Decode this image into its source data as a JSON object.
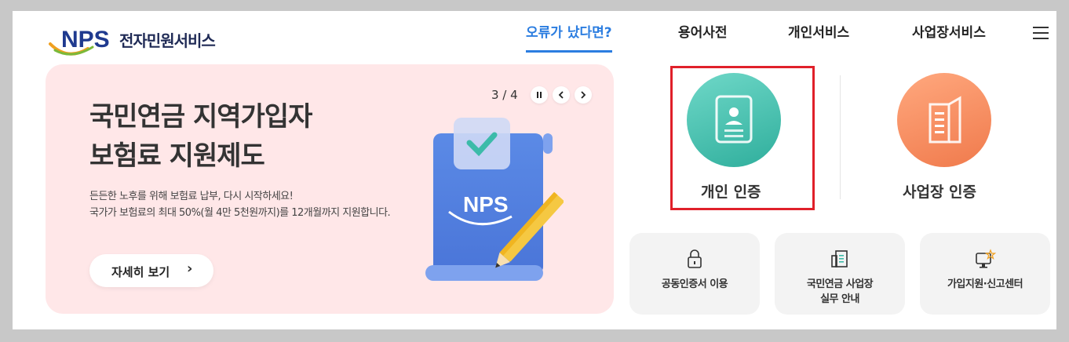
{
  "header": {
    "logo_text": "NPS",
    "service_name": "전자민원서비스"
  },
  "nav": {
    "items": [
      {
        "label": "오류가 났다면?",
        "active": true
      },
      {
        "label": "용어사전",
        "active": false
      },
      {
        "label": "개인서비스",
        "active": false
      },
      {
        "label": "사업장서비스",
        "active": false
      }
    ],
    "menu_icon": "hamburger-icon"
  },
  "banner": {
    "title_line1": "국민연금 지역가입자",
    "title_line2": "보험료 지원제도",
    "desc_line1": "든든한 노후를 위해 보험료 납부, 다시 시작하세요!",
    "desc_line2": "국가가 보험료의 최대 50%(월 4만 5천원까지)를 12개월까지 지원합니다.",
    "detail_button": "자세히 보기",
    "detail_chevron": "›",
    "pager": {
      "current": 3,
      "total": 4,
      "text": "3 / 4"
    },
    "pause_icon": "pause-icon",
    "prev_icon": "chevron-left-icon",
    "next_icon": "chevron-right-icon",
    "illustration_text": "NPS",
    "background": "#ffe7e8"
  },
  "auth": {
    "personal": {
      "label": "개인 인증",
      "icon": "id-card-icon",
      "color": "#3cbba9"
    },
    "business": {
      "label": "사업장 인증",
      "icon": "building-icon",
      "color": "#f5895a"
    },
    "highlight_color": "#e0202a"
  },
  "quick_links": [
    {
      "label_line1": "공동인증서 이용",
      "label_line2": "",
      "icon": "lock-icon"
    },
    {
      "label_line1": "국민연금 사업장",
      "label_line2": "실무 안내",
      "icon": "document-icon"
    },
    {
      "label_line1": "가입지원·신고센터",
      "label_line2": "",
      "icon": "monitor-icon"
    }
  ],
  "colors": {
    "accent": "#2b7de0",
    "brand_navy": "#1f2a55"
  }
}
